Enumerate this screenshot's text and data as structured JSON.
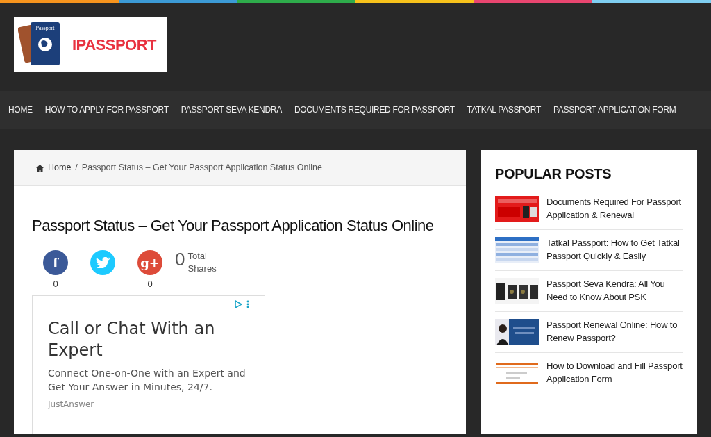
{
  "logo": {
    "booklet_label": "Passport",
    "wordmark": "IPASSPORT"
  },
  "nav": [
    {
      "label": "HOME"
    },
    {
      "label": "HOW TO APPLY FOR PASSPORT"
    },
    {
      "label": "PASSPORT SEVA KENDRA"
    },
    {
      "label": "DOCUMENTS REQUIRED FOR PASSPORT"
    },
    {
      "label": "TATKAL PASSPORT"
    },
    {
      "label": "PASSPORT APPLICATION FORM"
    }
  ],
  "breadcrumb": {
    "home": "Home",
    "separator": "/",
    "current": "Passport Status – Get Your Passport Application Status Online"
  },
  "article": {
    "title": "Passport Status – Get Your Passport Application Status Online"
  },
  "share": {
    "buttons": [
      {
        "kind": "facebook",
        "glyph": "f",
        "count": "0"
      },
      {
        "kind": "twitter"
      },
      {
        "kind": "googleplus",
        "glyph": "g+",
        "count": "0"
      }
    ],
    "total": "0",
    "total_label": "Total Shares"
  },
  "ad": {
    "headline": "Call or Chat With an Expert",
    "body": "Connect One-on-One with an Expert and Get Your Answer in Minutes, 24/7.",
    "advertiser": "JustAnswer"
  },
  "sidebar": {
    "title": "POPULAR POSTS",
    "posts": [
      {
        "title": "Documents Required For Passport Application & Renewal"
      },
      {
        "title": "Tatkal Passport: How to Get Tatkal Passport Quickly & Easily"
      },
      {
        "title": "Passport Seva Kendra: All You Need to Know About PSK"
      },
      {
        "title": "Passport Renewal Online: How to Renew Passport?"
      },
      {
        "title": "How to Download and Fill Passport Application Form"
      }
    ]
  }
}
